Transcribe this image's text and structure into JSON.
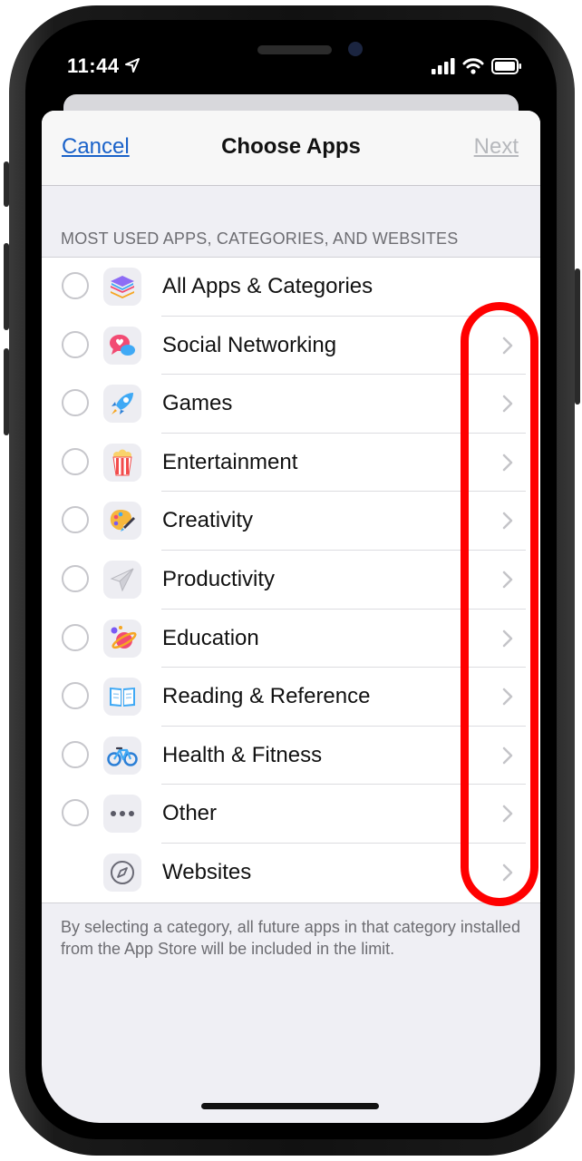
{
  "status_bar": {
    "time": "11:44"
  },
  "nav": {
    "cancel_label": "Cancel",
    "title": "Choose Apps",
    "next_label": "Next"
  },
  "section_header": "MOST USED APPS, CATEGORIES, AND WEBSITES",
  "rows": [
    {
      "label": "All Apps & Categories",
      "icon": "stack-icon",
      "radio": true,
      "chevron": false
    },
    {
      "label": "Social Networking",
      "icon": "chat-heart-icon",
      "radio": true,
      "chevron": true
    },
    {
      "label": "Games",
      "icon": "rocket-icon",
      "radio": true,
      "chevron": true
    },
    {
      "label": "Entertainment",
      "icon": "popcorn-icon",
      "radio": true,
      "chevron": true
    },
    {
      "label": "Creativity",
      "icon": "palette-icon",
      "radio": true,
      "chevron": true
    },
    {
      "label": "Productivity",
      "icon": "paper-plane-icon",
      "radio": true,
      "chevron": true
    },
    {
      "label": "Education",
      "icon": "planet-icon",
      "radio": true,
      "chevron": true
    },
    {
      "label": "Reading & Reference",
      "icon": "book-icon",
      "radio": true,
      "chevron": true
    },
    {
      "label": "Health & Fitness",
      "icon": "bicycle-icon",
      "radio": true,
      "chevron": true
    },
    {
      "label": "Other",
      "icon": "ellipsis-icon",
      "radio": true,
      "chevron": true
    },
    {
      "label": "Websites",
      "icon": "compass-icon",
      "radio": false,
      "chevron": true
    }
  ],
  "footer_note": "By selecting a category, all future apps in that category installed from the App Store will be included in the limit.",
  "colors": {
    "link": "#1a62c9",
    "disabled": "#b6b8bc",
    "highlight": "#ff0000"
  }
}
